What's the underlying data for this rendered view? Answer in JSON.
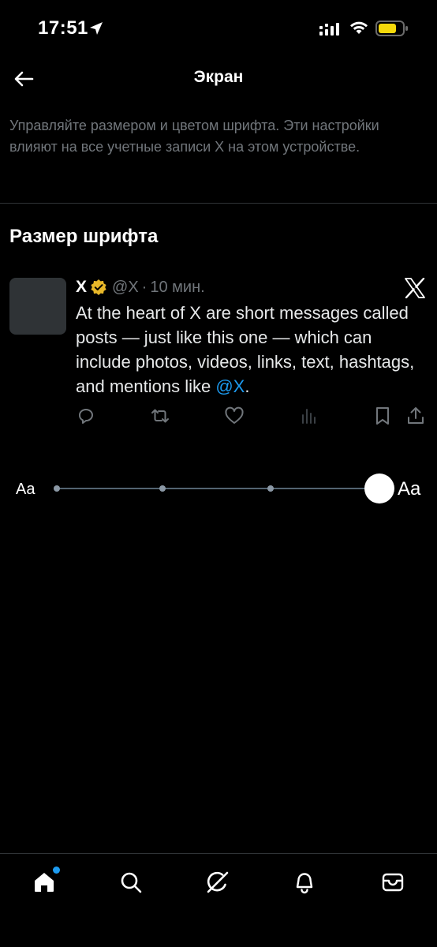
{
  "status_bar": {
    "time": "17:51",
    "battery_color": "#f5d90a"
  },
  "header": {
    "title": "Экран",
    "back_icon": "arrow-left-icon"
  },
  "description": "Управляйте размером и цветом шрифта. Эти настройки влияют на все учетные записи X на этом устройстве.",
  "font_size_section": {
    "title": "Размер шрифта"
  },
  "post": {
    "name": "X",
    "handle": "@X",
    "separator": "·",
    "time": "10 мин.",
    "text_before_mention": "At the heart of X are short messages called posts — just like this one — which can include photos, videos, links, text, hashtags, and mentions like ",
    "mention": "@X",
    "text_after_mention": ".",
    "verified_color": "#e8b829",
    "mention_color": "#1d9bf0",
    "actions": [
      "reply-icon",
      "repost-icon",
      "like-icon",
      "views-icon",
      "bookmark-icon",
      "share-icon"
    ]
  },
  "font_slider": {
    "min_label": "Aa",
    "max_label": "Aa",
    "steps": 5,
    "selected_step": 5
  },
  "tab_bar": {
    "tabs": [
      "home-icon",
      "search-icon",
      "grok-icon",
      "notifications-icon",
      "messages-icon"
    ],
    "active": "home-icon",
    "accent": "#1d9bf0"
  }
}
